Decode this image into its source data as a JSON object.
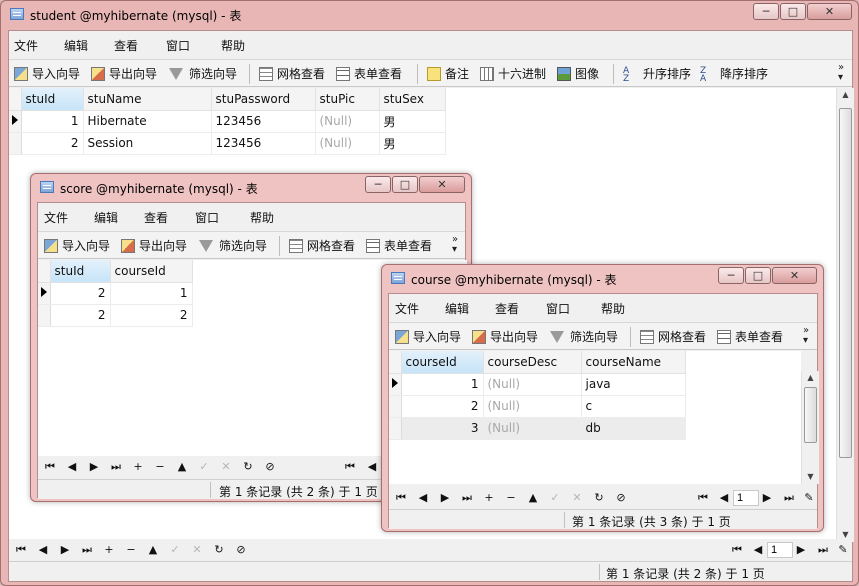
{
  "student_window": {
    "title": "student @myhibernate (mysql) - 表",
    "menu": [
      "文件",
      "编辑",
      "查看",
      "窗口",
      "帮助"
    ],
    "toolbar": {
      "import": "导入向导",
      "export": "导出向导",
      "filter": "筛选向导",
      "grid_view": "网格查看",
      "form_view": "表单查看",
      "memo": "备注",
      "hex": "十六进制",
      "image": "图像",
      "sort_asc": "升序排序",
      "sort_desc": "降序排序"
    },
    "columns": [
      "stuId",
      "stuName",
      "stuPassword",
      "stuPic",
      "stuSex"
    ],
    "rows": [
      [
        "1",
        "Hibernate",
        "123456",
        "(Null)",
        "男"
      ],
      [
        "2",
        "Session",
        "123456",
        "(Null)",
        "男"
      ]
    ],
    "nav": {
      "record_no": "1"
    },
    "status": "第 1 条记录 (共 2 条) 于 1 页"
  },
  "score_window": {
    "title": "score @myhibernate (mysql) - 表",
    "menu": [
      "文件",
      "编辑",
      "查看",
      "窗口",
      "帮助"
    ],
    "toolbar": {
      "import": "导入向导",
      "export": "导出向导",
      "filter": "筛选向导",
      "grid_view": "网格查看",
      "form_view": "表单查看"
    },
    "columns": [
      "stuId",
      "courseId"
    ],
    "rows": [
      [
        "2",
        "1"
      ],
      [
        "2",
        "2"
      ]
    ],
    "status": "第 1 条记录 (共 2 条) 于 1 页"
  },
  "course_window": {
    "title": "course @myhibernate (mysql) - 表",
    "menu": [
      "文件",
      "编辑",
      "查看",
      "窗口",
      "帮助"
    ],
    "toolbar": {
      "import": "导入向导",
      "export": "导出向导",
      "filter": "筛选向导",
      "grid_view": "网格查看",
      "form_view": "表单查看"
    },
    "columns": [
      "courseId",
      "courseDesc",
      "courseName"
    ],
    "rows": [
      [
        "1",
        "(Null)",
        "java"
      ],
      [
        "2",
        "(Null)",
        "c"
      ],
      [
        "3",
        "(Null)",
        "db"
      ]
    ],
    "nav": {
      "record_no": "1"
    },
    "status": "第 1 条记录 (共 3 条) 于 1 页"
  },
  "window_controls": {
    "minimize": "─",
    "maximize": "□",
    "close": "✕"
  },
  "colors": {
    "title_bg": "#e9b6b6",
    "selected_header": "#c7e4f8",
    "null_text": "#a8a8a8"
  }
}
